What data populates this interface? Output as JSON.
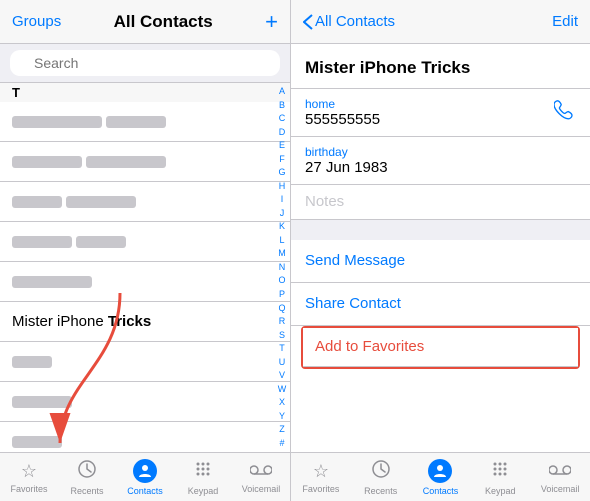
{
  "left": {
    "header": {
      "groups_label": "Groups",
      "title": "All Contacts",
      "add_icon": "+"
    },
    "search": {
      "placeholder": "Search"
    },
    "sections": [
      {
        "letter": "T",
        "contacts": [
          {
            "id": 1,
            "blurred": true,
            "widths": [
              90,
              60
            ]
          },
          {
            "id": 2,
            "blurred": true,
            "widths": [
              70,
              80
            ]
          },
          {
            "id": 3,
            "blurred": true,
            "widths": [
              50,
              70
            ]
          },
          {
            "id": 4,
            "blurred": true,
            "widths": [
              60,
              50
            ]
          },
          {
            "id": 5,
            "blurred": true,
            "widths": [
              80,
              0
            ]
          },
          {
            "id": 6,
            "name_plain": "Mister iPhone ",
            "name_bold": "Tricks",
            "blurred": false
          }
        ]
      },
      {
        "letter": "",
        "contacts": [
          {
            "id": 7,
            "blurred": true,
            "widths": [
              40,
              0
            ]
          },
          {
            "id": 8,
            "blurred": true,
            "widths": [
              60,
              0
            ]
          },
          {
            "id": 9,
            "blurred": true,
            "widths": [
              50,
              0
            ]
          }
        ]
      }
    ],
    "alpha": [
      "A",
      "B",
      "C",
      "D",
      "E",
      "F",
      "G",
      "H",
      "I",
      "J",
      "K",
      "L",
      "M",
      "N",
      "O",
      "P",
      "Q",
      "R",
      "S",
      "T",
      "U",
      "V",
      "W",
      "X",
      "Y",
      "Z",
      "#"
    ],
    "tabs": [
      {
        "id": "favorites",
        "label": "Favorites",
        "icon": "☆",
        "active": false
      },
      {
        "id": "recents",
        "label": "Recents",
        "icon": "⊙",
        "active": false
      },
      {
        "id": "contacts",
        "label": "Contacts",
        "icon": "person",
        "active": true
      },
      {
        "id": "keypad",
        "label": "Keypad",
        "icon": "⠿",
        "active": false
      },
      {
        "id": "voicemail",
        "label": "Voicemail",
        "icon": "⊜",
        "active": false
      }
    ]
  },
  "right": {
    "header": {
      "back_label": "All Contacts",
      "edit_label": "Edit"
    },
    "contact": {
      "name_plain": "Mister iPhone ",
      "name_bold": "Tricks"
    },
    "fields": [
      {
        "id": "phone",
        "label": "home",
        "value": "555555555",
        "has_phone_icon": true
      },
      {
        "id": "birthday",
        "label": "birthday",
        "value": "27 Jun 1983",
        "has_phone_icon": false
      }
    ],
    "notes_placeholder": "Notes",
    "actions": [
      {
        "id": "send-message",
        "label": "Send Message",
        "highlighted": false
      },
      {
        "id": "share-contact",
        "label": "Share Contact",
        "highlighted": false
      },
      {
        "id": "add-to-favorites",
        "label": "Add to Favorites",
        "highlighted": true
      }
    ],
    "tabs": [
      {
        "id": "favorites",
        "label": "Favorites",
        "icon": "☆",
        "active": false
      },
      {
        "id": "recents",
        "label": "Recents",
        "icon": "⊙",
        "active": false
      },
      {
        "id": "contacts",
        "label": "Contacts",
        "icon": "person",
        "active": true
      },
      {
        "id": "keypad",
        "label": "Keypad",
        "icon": "⠿",
        "active": false
      },
      {
        "id": "voicemail",
        "label": "Voicemail",
        "icon": "⊜",
        "active": false
      }
    ]
  }
}
